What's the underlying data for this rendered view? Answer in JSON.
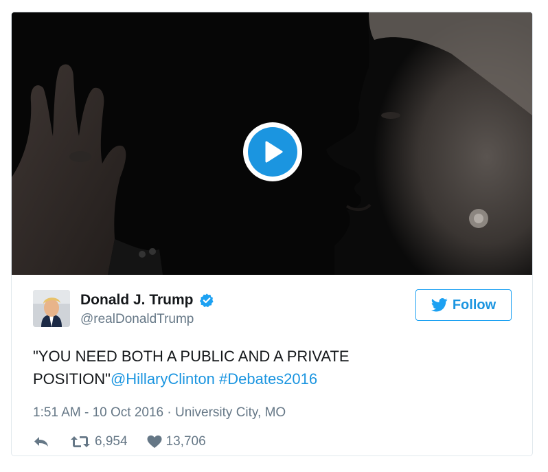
{
  "media": {
    "type": "video",
    "play_icon": "play-icon"
  },
  "author": {
    "display_name": "Donald J. Trump",
    "screen_name": "@realDonaldTrump",
    "verified_icon": "verified-badge-icon",
    "avatar_icon": "avatar"
  },
  "follow": {
    "label": "Follow",
    "icon": "twitter-bird-icon"
  },
  "tweet": {
    "text_part1": "\"YOU NEED BOTH A PUBLIC AND A PRIVATE POSITION\"",
    "mention": "@HillaryClinton",
    "hashtag": "#Debates2016"
  },
  "meta": {
    "time": "1:51 AM - 10 Oct 2016",
    "separator": "·",
    "location": "University City, MO"
  },
  "actions": {
    "reply_icon": "reply-icon",
    "retweet_icon": "retweet-icon",
    "retweet_count": "6,954",
    "like_icon": "heart-icon",
    "like_count": "13,706"
  },
  "colors": {
    "accent": "#1b95e0",
    "text": "#14171a",
    "muted": "#657786",
    "border": "#e1e8ed"
  }
}
